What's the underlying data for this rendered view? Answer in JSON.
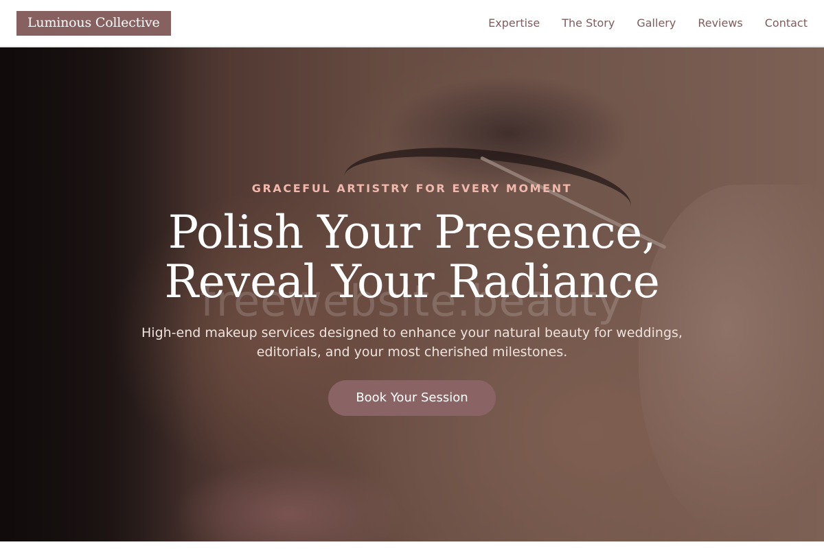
{
  "header": {
    "brand": "Luminous Collective",
    "nav": [
      {
        "label": "Expertise"
      },
      {
        "label": "The Story"
      },
      {
        "label": "Gallery"
      },
      {
        "label": "Reviews"
      },
      {
        "label": "Contact"
      }
    ]
  },
  "hero": {
    "eyebrow": "GRACEFUL ARTISTRY FOR EVERY MOMENT",
    "title": "Polish Your Presence, Reveal Your Radiance",
    "subtitle": "High-end makeup services designed to enhance your natural beauty for weddings, editorials, and your most cherished milestones.",
    "cta_label": "Book Your Session",
    "watermark": "freewebsite.beauty",
    "image_alt": "close-up of makeup artist applying lashes"
  },
  "colors": {
    "brand": "#876060",
    "nav_text": "#7d5d5d",
    "eyebrow": "#f2b8ad",
    "cta_bg": "#8a6464"
  }
}
